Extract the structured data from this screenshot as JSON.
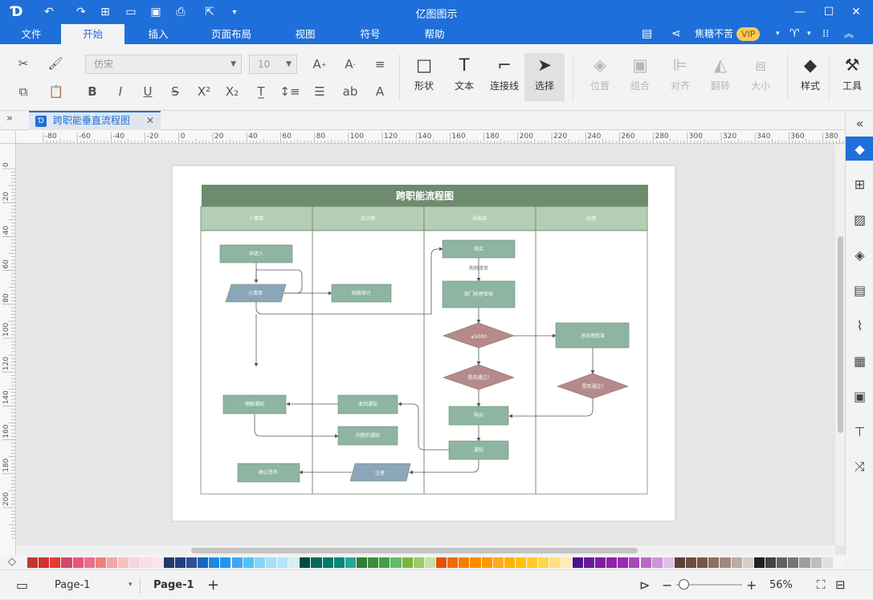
{
  "app": {
    "title": "亿图图示"
  },
  "menu": {
    "tabs": [
      "文件",
      "开始",
      "插入",
      "页面布局",
      "视图",
      "符号",
      "帮助"
    ],
    "active_tab": "开始",
    "user_name": "焦糖不苦",
    "vip_label": "VIP"
  },
  "ribbon": {
    "font_family": "仿宋",
    "font_size": "10",
    "tools": {
      "shape": "形状",
      "text": "文本",
      "connector": "连接线",
      "select": "选择",
      "position": "位置",
      "group": "组合",
      "align": "对齐",
      "flip": "翻转",
      "size": "大小",
      "style": "样式",
      "tools": "工具"
    }
  },
  "document": {
    "tab_title": "跨职能垂直流程图"
  },
  "ruler": {
    "h_labels": [
      "-80",
      "-60",
      "-40",
      "-20",
      "0",
      "20",
      "40",
      "60",
      "80",
      "100",
      "120",
      "140",
      "160",
      "180",
      "200",
      "220",
      "240",
      "260",
      "280",
      "300",
      "320",
      "340",
      "360",
      "380"
    ],
    "v_labels": [
      "0",
      "20",
      "40",
      "60",
      "80",
      "100",
      "120",
      "140",
      "160",
      "180",
      "200"
    ]
  },
  "diagram": {
    "title": "跨职能流程图",
    "lanes": [
      "人事部",
      "会计部",
      "采购部",
      "经理"
    ],
    "nodes": {
      "applicant": "申请人",
      "fill_form": "小清单",
      "online_audit": "网络审计",
      "purchase": "购买",
      "purchase_list": "购物清单",
      "dept_review": "部门经理审核",
      "amount": "≤5000",
      "manager_review": "总经理批准",
      "pass1": "是否通过?",
      "pass2": "是否通过?",
      "buy": "购买",
      "notify_finance": "收到通知",
      "explain_notice": "理解通知",
      "issue_notice": "问题的通知",
      "notice": "通知",
      "register": "注册",
      "confirm_sign": "确认签名"
    }
  },
  "statusbar": {
    "page_selector": "Page-1",
    "current_page": "Page-1",
    "zoom": "56%"
  },
  "palette": {
    "colors": [
      "#c0392b",
      "#d32f2f",
      "#e53935",
      "#d6456e",
      "#e75480",
      "#ec6f8d",
      "#f08080",
      "#f4a6a6",
      "#f7c1c1",
      "#f8d3dd",
      "#fadbe6",
      "#fce4ec",
      "#1f3a6e",
      "#23407a",
      "#2c4f94",
      "#1565c0",
      "#1e88e5",
      "#2196f3",
      "#42a5f5",
      "#4fc3f7",
      "#81d4fa",
      "#a7def5",
      "#b3e5fc",
      "#d6eefa",
      "#004d40",
      "#00695c",
      "#00796b",
      "#00897b",
      "#26a69a",
      "#2e7d32",
      "#388e3c",
      "#43a047",
      "#66bb6a",
      "#7cb342",
      "#9ccc65",
      "#c5e1a5",
      "#e65100",
      "#ef6c00",
      "#f57c00",
      "#fb8c00",
      "#ff9800",
      "#ffa726",
      "#ffb300",
      "#ffc107",
      "#ffca28",
      "#ffd54f",
      "#ffe082",
      "#ffecb3",
      "#4a148c",
      "#6a1b9a",
      "#7b1fa2",
      "#8e24aa",
      "#9c27b0",
      "#ab47bc",
      "#ba68c8",
      "#ce93d8",
      "#e1bee7",
      "#5d4037",
      "#6d4c41",
      "#795548",
      "#8d6e63",
      "#a1887f",
      "#bcaaa4",
      "#d7ccc8",
      "#212121",
      "#424242",
      "#616161",
      "#757575",
      "#9e9e9e",
      "#bdbdbd",
      "#e0e0e0",
      "#f5f5f5"
    ]
  },
  "colors": {
    "accent": "#1e6fd9",
    "header_fill": "#6e8b6e",
    "lane_header_fill": "#b5cdb5",
    "process_fill": "#8db5a2",
    "decision_fill": "#b58a8a",
    "data_fill": "#8ba6b8"
  }
}
